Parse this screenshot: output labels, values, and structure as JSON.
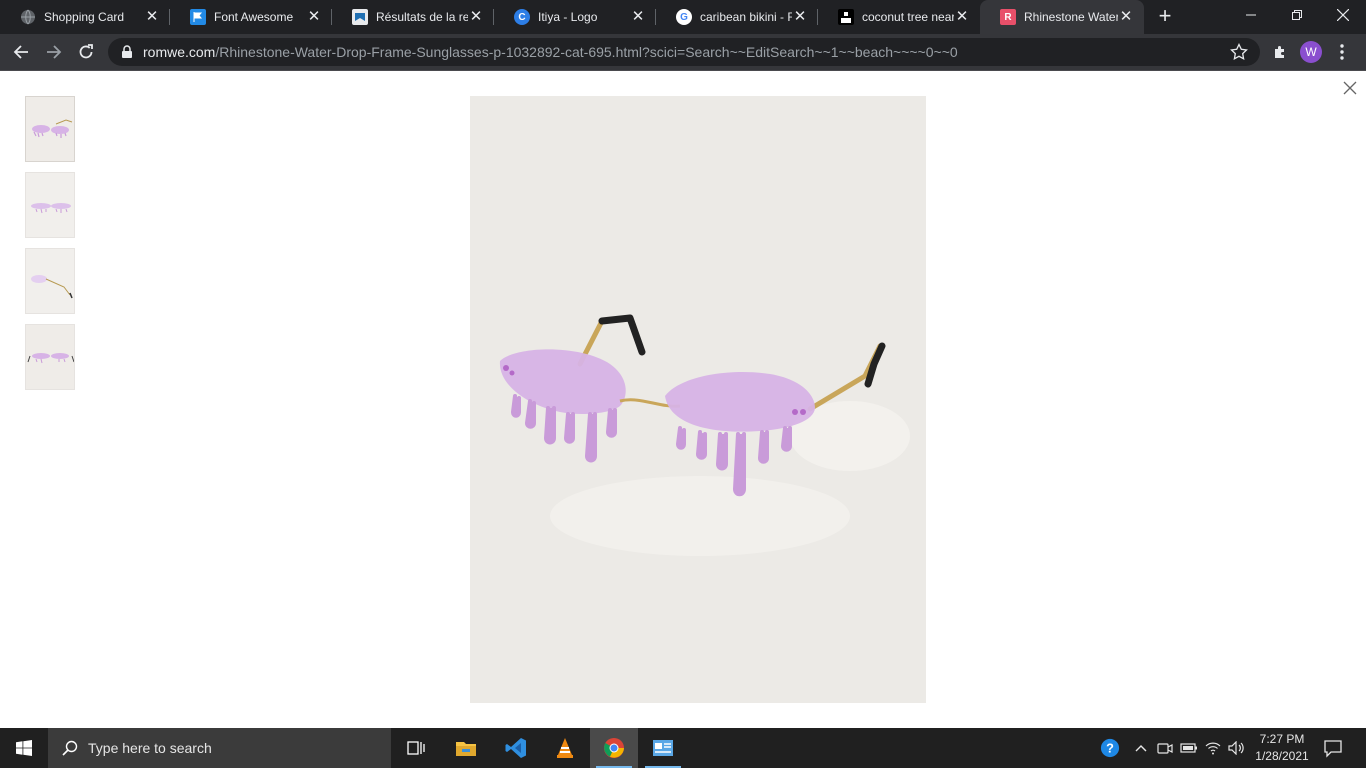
{
  "tabs": [
    {
      "title": "Shopping Card",
      "icon": "globe-icon"
    },
    {
      "title": "Font Awesome",
      "icon": "font-awesome-flag-icon"
    },
    {
      "title": "Résultats de la rech",
      "icon": "bookmark-site-icon"
    },
    {
      "title": "Itiya - Logo",
      "icon": "canva-icon"
    },
    {
      "title": "caribean bikini - Re",
      "icon": "google-icon"
    },
    {
      "title": "coconut tree near",
      "icon": "site-icon"
    },
    {
      "title": "Rhinestone Water",
      "icon": "romwe-icon"
    }
  ],
  "address": {
    "host": "romwe.com",
    "path": "/Rhinestone-Water-Drop-Frame-Sunglasses-p-1032892-cat-695.html?scici=Search~~EditSearch~~1~~beach~~~~0~~0"
  },
  "profile": {
    "initial": "W"
  },
  "viewer": {
    "thumbnail_count": 4,
    "selected_index": 0
  },
  "taskbar": {
    "search_placeholder": "Type here to search",
    "time": "7:27 PM",
    "date": "1/28/2021"
  },
  "colors": {
    "tab_strip": "#202124",
    "toolbar": "#35363a",
    "photo_bg": "#eceae6",
    "lens": "#d7b3e6",
    "romwe_brand": "#e8506a",
    "avatar": "#8a4fcf"
  }
}
